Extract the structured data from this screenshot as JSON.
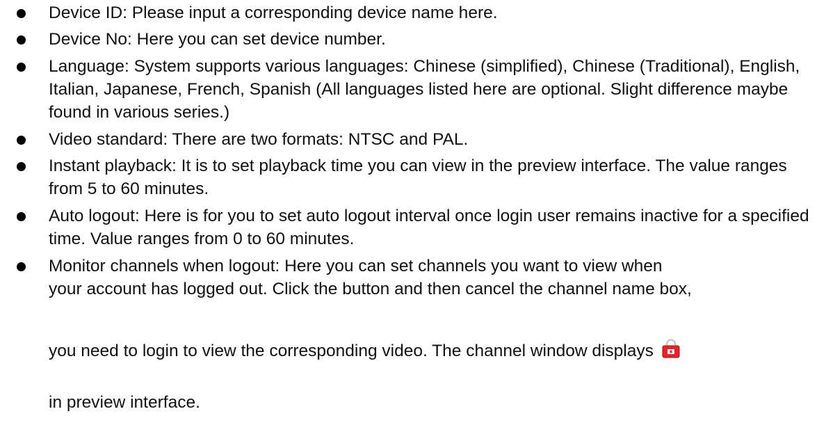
{
  "items": [
    "Device ID: Please input a corresponding device name here.",
    "Device No: Here you can set device number.",
    "Language: System supports various languages: Chinese (simplified), Chinese (Traditional), English, Italian, Japanese, French, Spanish (All languages listed here are optional. Slight difference maybe found in various series.)",
    "Video standard: There are two formats: NTSC and PAL.",
    "Instant playback: It is to set playback time you can view in the preview interface. The value ranges from 5 to 60 minutes.",
    "Auto logout: Here is for you to set auto logout interval once login user remains inactive for a specified time. Value ranges from 0 to 60 minutes."
  ],
  "monitor_item": {
    "line1": "Monitor channels when logout: Here you can set channels you want to view when",
    "line2": "your account has logged out. Click the button and then cancel the channel name box,",
    "line3": "you need to login to view the corresponding video. The channel window displays",
    "line4": "in preview interface.",
    "icon": "lock-icon",
    "icon_color": "#e8202a"
  },
  "bullet_color": "#000000"
}
